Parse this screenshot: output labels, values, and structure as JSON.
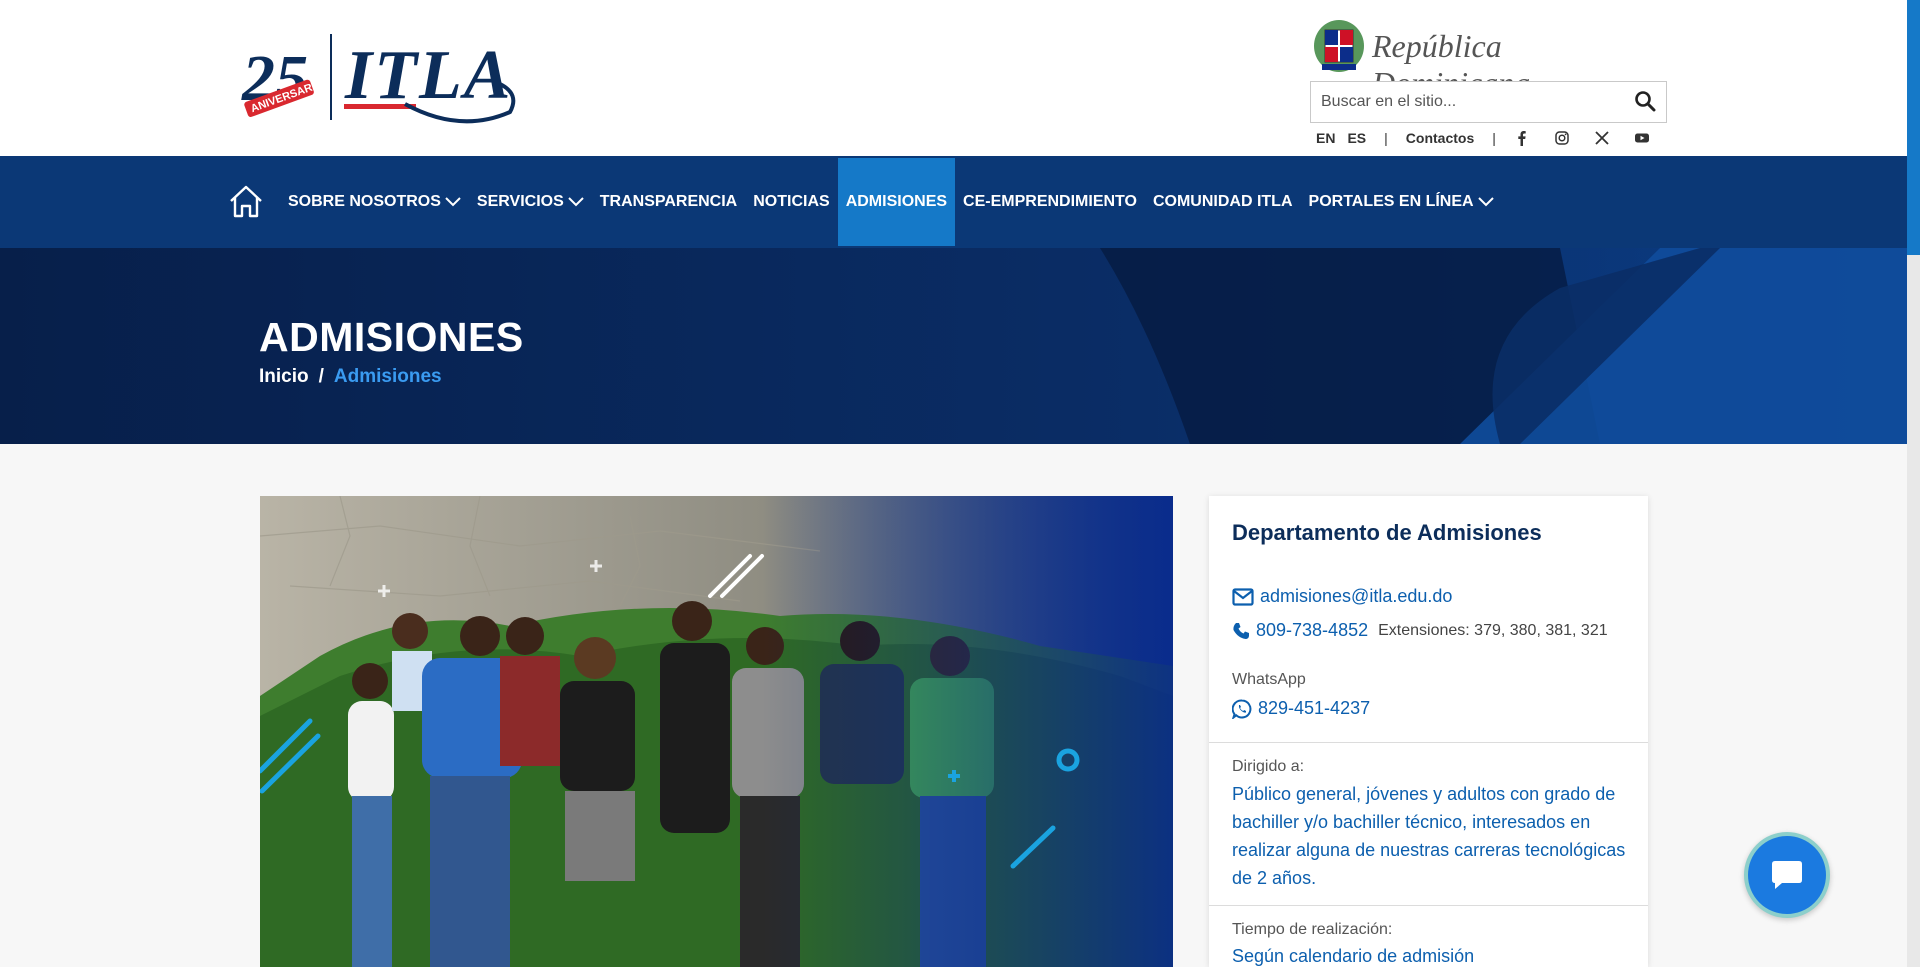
{
  "header": {
    "logo": {
      "anniversary_number": "25",
      "anniversary_label": "ANIVERSARIO",
      "brand": "ITLA"
    },
    "gov": {
      "text": "República Dominicana"
    },
    "search": {
      "placeholder": "Buscar en el sitio..."
    },
    "utility": {
      "lang_en": "EN",
      "lang_es": "ES",
      "separator": "|",
      "contacts": "Contactos"
    },
    "social_icons": [
      "facebook-icon",
      "instagram-icon",
      "x-icon",
      "youtube-icon"
    ]
  },
  "nav": {
    "items": [
      {
        "label": "SOBRE NOSOTROS",
        "dropdown": true
      },
      {
        "label": "SERVICIOS",
        "dropdown": true
      },
      {
        "label": "TRANSPARENCIA",
        "dropdown": false
      },
      {
        "label": "NOTICIAS",
        "dropdown": false
      },
      {
        "label": "ADMISIONES",
        "dropdown": false,
        "active": true
      },
      {
        "label": "CE-EMPRENDIMIENTO",
        "dropdown": false
      },
      {
        "label": "COMUNIDAD ITLA",
        "dropdown": false
      },
      {
        "label": "PORTALES EN LÍNEA",
        "dropdown": true
      }
    ]
  },
  "hero": {
    "title": "ADMISIONES",
    "breadcrumb": {
      "home": "Inicio",
      "separator": "/",
      "current": "Admisiones"
    }
  },
  "card": {
    "title": "Departamento de Admisiones",
    "email": "admisiones@itla.edu.do",
    "phone": "809-738-4852",
    "extensions": "Extensiones: 379, 380, 381, 321",
    "whatsapp_label": "WhatsApp",
    "whatsapp": "829-451-4237",
    "audience_label": "Dirigido a:",
    "audience": "Público general, jóvenes y adultos con grado de bachiller y/o bachiller técnico, interesados en realizar alguna de nuestras carreras tecnológicas de 2 años.",
    "duration_label": "Tiempo de realización:",
    "duration": "Según calendario de admisión"
  },
  "colors": {
    "nav_bg": "#0b3876",
    "nav_active": "#1579c8",
    "hero_bg": "#0a2a5e",
    "link_blue": "#0c5fae",
    "brand_navy": "#0c2d5a"
  }
}
